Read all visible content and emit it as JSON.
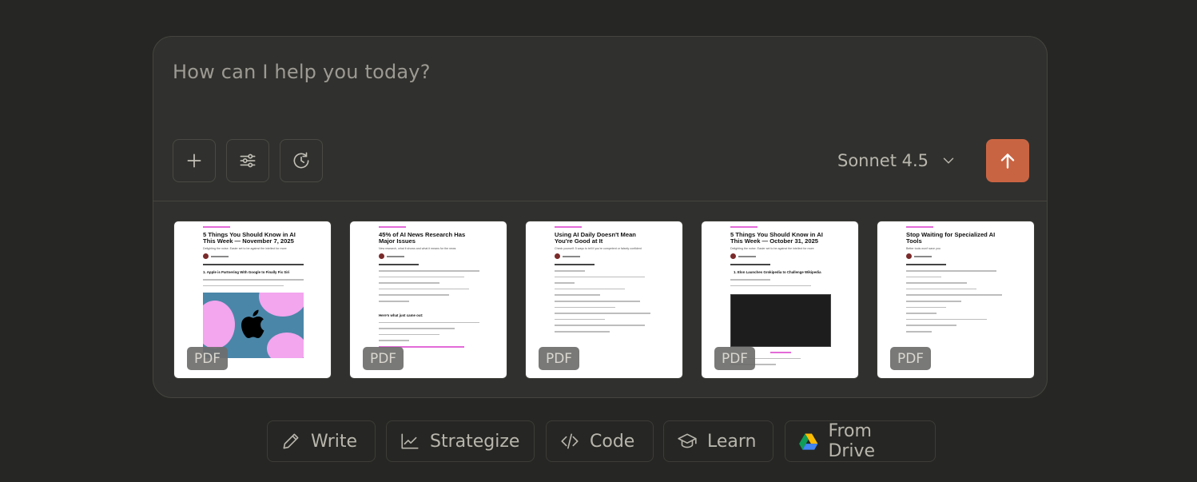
{
  "composer": {
    "placeholder": "How can I help you today?",
    "model": "Sonnet 4.5",
    "send_color": "#c96442"
  },
  "tools": [
    {
      "name": "add-button",
      "icon": "plus-icon"
    },
    {
      "name": "settings-button",
      "icon": "sliders-icon"
    },
    {
      "name": "history-button",
      "icon": "clock-history-icon"
    }
  ],
  "attachments": [
    {
      "type": "PDF",
      "title": "5 Things You Should Know in AI This Week — November 7, 2025",
      "section": "1. Apple is Partnering With Google to Finally Fix Siri",
      "image": "apple"
    },
    {
      "type": "PDF",
      "title": "45% of AI News Research Has Major Issues",
      "section": "Here's what just came out:",
      "image": "none"
    },
    {
      "type": "PDF",
      "title": "Using AI Daily Doesn't Mean You're Good at It",
      "section": "",
      "image": "none"
    },
    {
      "type": "PDF",
      "title": "5 Things You Should Know in AI This Week — October 31, 2025",
      "section": "1. Elon Launches Grokipedia to Challenge Wikipedia",
      "image": "dark"
    },
    {
      "type": "PDF",
      "title": "Stop Waiting for Specialized AI Tools",
      "section": "",
      "image": "none"
    }
  ],
  "suggestions": [
    {
      "label": "Write",
      "icon": "pencil-icon"
    },
    {
      "label": "Strategize",
      "icon": "chart-line-icon"
    },
    {
      "label": "Code",
      "icon": "code-icon"
    },
    {
      "label": "Learn",
      "icon": "graduation-cap-icon"
    },
    {
      "label": "From Drive",
      "icon": "google-drive-icon"
    }
  ]
}
